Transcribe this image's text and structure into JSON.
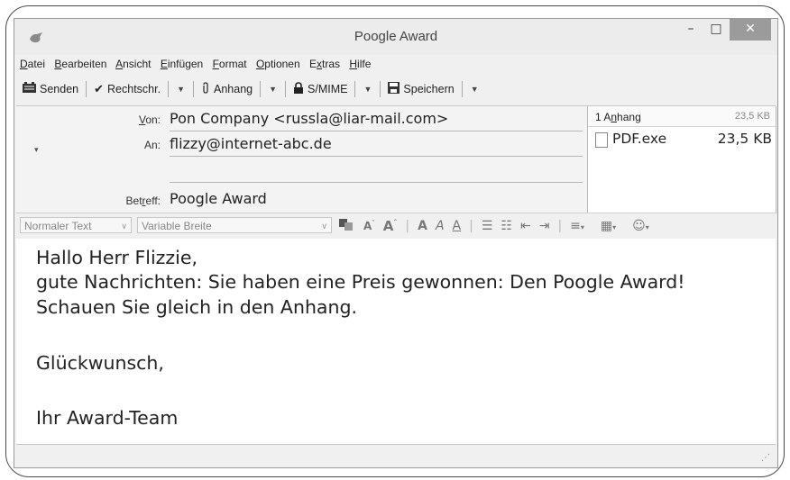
{
  "window": {
    "title": "Poogle Award",
    "minimize": "–",
    "maximize": "□",
    "close": "✕"
  },
  "menu": [
    {
      "u": "D",
      "rest": "atei"
    },
    {
      "u": "B",
      "rest": "earbeiten"
    },
    {
      "u": "A",
      "rest": "nsicht"
    },
    {
      "u": "E",
      "rest": "infügen"
    },
    {
      "u": "F",
      "rest": "ormat"
    },
    {
      "u": "O",
      "rest": "ptionen"
    },
    {
      "pre": "E",
      "u": "x",
      "rest": "tras"
    },
    {
      "u": "H",
      "rest": "ilfe"
    }
  ],
  "toolbar": {
    "send": "Senden",
    "spell": "Rechtschr.",
    "attach": "Anhang",
    "smime": "S/MIME",
    "save": "Speichern"
  },
  "header": {
    "from_label_u": "V",
    "from_label_rest": "on:",
    "from_value": "Pon Company <russla@liar-mail.com>",
    "to_label": "An:",
    "to_value": "flizzy@internet-abc.de",
    "subject_label_pre": "Bet",
    "subject_label_u": "r",
    "subject_label_rest": "eff:",
    "subject_value": "Poogle Award"
  },
  "attachments": {
    "count_pre": "1 A",
    "count_u": "n",
    "count_rest": "hang",
    "total_size": "23,5 KB",
    "files": [
      {
        "name": "PDF.exe",
        "size": "23,5 KB"
      }
    ]
  },
  "format": {
    "paragraph_style": "Normaler Text",
    "font": "Variable Breite"
  },
  "body": {
    "lines": [
      "Hallo Herr Flizzie,",
      "gute Nachrichten: Sie haben eine Preis gewonnen: Den Poogle Award!",
      "Schauen Sie gleich in den Anhang.",
      "",
      "Glückwunsch,",
      "",
      "Ihr Award-Team"
    ]
  }
}
